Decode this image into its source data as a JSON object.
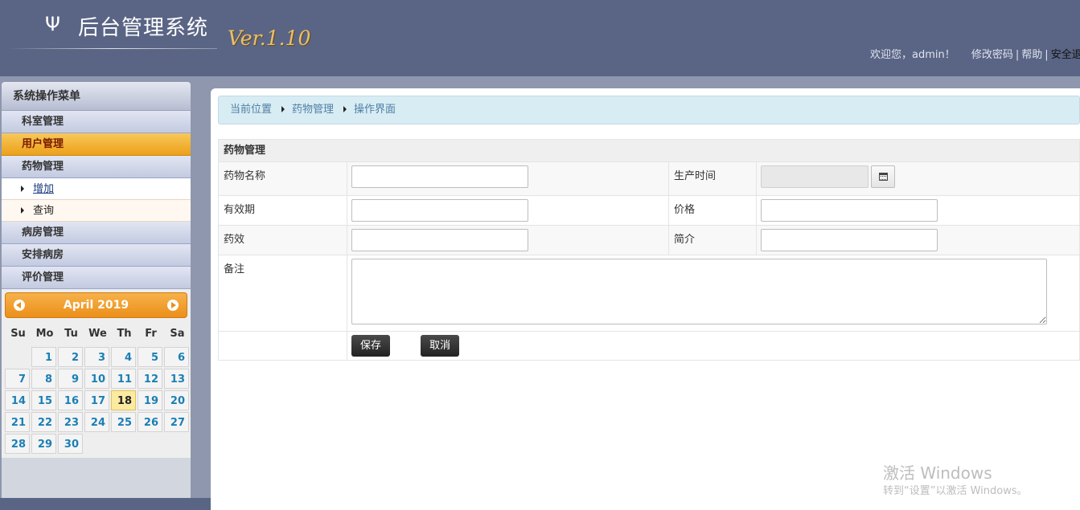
{
  "header": {
    "logo_glyph": "Ψ",
    "title": "后台管理系统",
    "version": "Ver.1.10",
    "welcome": "欢迎您，admin！",
    "change_password": "修改密码",
    "help": "帮助",
    "logout": "安全退出",
    "separator": "|"
  },
  "sidebar": {
    "title": "系统操作菜单",
    "menu": [
      {
        "label": "科室管理"
      },
      {
        "label": "用户管理",
        "active": true
      },
      {
        "label": "药物管理"
      }
    ],
    "submenu": [
      {
        "label": "增加"
      },
      {
        "label": "查询"
      }
    ],
    "menu_after": [
      {
        "label": "病房管理"
      },
      {
        "label": "安排病房"
      },
      {
        "label": "评价管理"
      }
    ]
  },
  "calendar": {
    "month_label": "April 2019",
    "weekdays": [
      "Su",
      "Mo",
      "Tu",
      "We",
      "Th",
      "Fr",
      "Sa"
    ],
    "first_weekday_index": 1,
    "days_in_month": 30,
    "today": 18
  },
  "breadcrumb": {
    "items": [
      "当前位置",
      "药物管理",
      "操作界面"
    ]
  },
  "form": {
    "caption": "药物管理",
    "name_label": "药物名称",
    "name_value": "",
    "production_label": "生产时间",
    "production_value": "",
    "expiry_label": "有效期",
    "expiry_value": "",
    "price_label": "价格",
    "price_value": "",
    "effect_label": "药效",
    "effect_value": "",
    "intro_label": "简介",
    "intro_value": "",
    "remark_label": "备注",
    "remark_value": "",
    "save_label": "保存",
    "cancel_label": "取消"
  },
  "watermark": {
    "title": "激活 Windows",
    "subtitle": "转到“设置”以激活 Windows。"
  },
  "colors": {
    "header_bg": "#5a6585",
    "active_menu": "#eda01a",
    "breadcrumb_bg": "#d8ecf3",
    "calendar_today": "#fbeaa0"
  }
}
